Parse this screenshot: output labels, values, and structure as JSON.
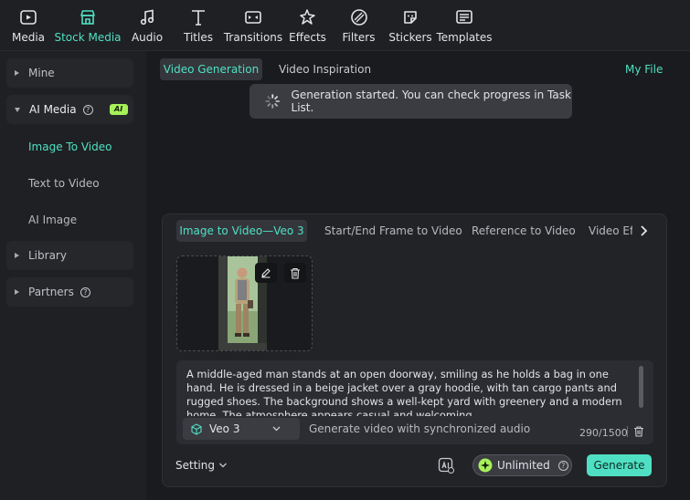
{
  "toolbar": {
    "items": [
      {
        "label": "Media",
        "icon": "media-icon"
      },
      {
        "label": "Stock Media",
        "icon": "stock-media-icon",
        "active": true
      },
      {
        "label": "Audio",
        "icon": "music-note-icon"
      },
      {
        "label": "Titles",
        "icon": "text-t-icon"
      },
      {
        "label": "Transitions",
        "icon": "transitions-icon"
      },
      {
        "label": "Effects",
        "icon": "effects-sparkle-icon"
      },
      {
        "label": "Filters",
        "icon": "filters-icon"
      },
      {
        "label": "Stickers",
        "icon": "sticker-icon"
      },
      {
        "label": "Templates",
        "icon": "templates-icon"
      }
    ]
  },
  "sidebar": {
    "groups": [
      {
        "label": "Mine"
      },
      {
        "label": "AI Media",
        "badge": "AI"
      },
      {
        "label": "Library"
      },
      {
        "label": "Partners"
      }
    ],
    "ai_media_items": [
      {
        "label": "Image To Video",
        "active": true
      },
      {
        "label": "Text to Video"
      },
      {
        "label": "AI Image"
      }
    ]
  },
  "main": {
    "tabs": [
      "Video Generation",
      "Video Inspiration"
    ],
    "my_file": "My File",
    "toast": "Generation started. You can check progress in Task List."
  },
  "panel": {
    "tabs": [
      "Image to Video—Veo 3",
      "Start/End Frame to Video",
      "Reference to Video",
      "Video Effects"
    ],
    "prompt": "A middle-aged man stands at an open doorway, smiling as he holds a bag in one hand. He is dressed in a beige jacket over a gray hoodie, with tan cargo pants and rugged shoes. The background shows a well-kept yard with greenery and a modern home. The atmosphere appears casual and welcoming.",
    "model": "Veo 3",
    "audio_option": "Generate video with synchronized audio",
    "char_count": "290/1500",
    "setting": "Setting",
    "unlimited": "Unlimited",
    "generate": "Generate"
  },
  "colors": {
    "accent": "#4fe0c3",
    "badge": "#a7f05a",
    "background": "#1a1b1e"
  }
}
